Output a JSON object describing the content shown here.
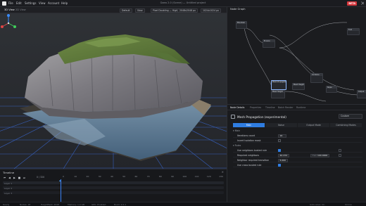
{
  "menubar": {
    "items": [
      "File",
      "Edit",
      "Settings",
      "View",
      "Account",
      "Help"
    ],
    "title": "Gaea 2.0 (Scene) — Untitled project",
    "beta": "BETA"
  },
  "viewport_toolbar": {
    "tabs": [
      "3D View",
      "2D View"
    ],
    "pills": [
      "Default",
      "View",
      "Pixel Doubling — High",
      "2048x2048 px",
      "1024x1024 px"
    ]
  },
  "node_graph": {
    "title": "Node Graph",
    "nodes": [
      "Mountain",
      "Erosion",
      "Mesh Propagation",
      "Fold",
      "Mask Height",
      "Combine",
      "Slope",
      "Mesh Height",
      "Output"
    ]
  },
  "details": {
    "panel_tabs": [
      "Node Details",
      "Properties",
      "Timeline",
      "Batch Render",
      "Runtime"
    ],
    "node_name": "Mesh Propagation (experimental)",
    "preset": "Custom",
    "mode_tabs": [
      "Main",
      "Noise",
      "Output Mode",
      "Combining Modes"
    ],
    "sections": {
      "main": "Main",
      "rules": "Rules"
    },
    "rows": [
      {
        "label": "Iterations count",
        "value": "16",
        "type": "value"
      },
      {
        "label": "Invert Isolation mask",
        "type": "check",
        "checked": false
      },
      {
        "label": "Use neighbors busted rule",
        "type": "check",
        "checked": true
      },
      {
        "label": "Required neighbors",
        "value": "40.234",
        "max_label": "max",
        "max_value": "100.0000",
        "type": "range"
      },
      {
        "label": "Neighbor required transition",
        "value": "5.000",
        "type": "value"
      },
      {
        "label": "Use cross busted rule",
        "type": "check",
        "checked": true
      }
    ]
  },
  "timeline": {
    "title": "Timeline",
    "frame": "0 / 320",
    "ticks": [
      "0",
      "10",
      "20",
      "30",
      "40",
      "50",
      "60",
      "70",
      "80",
      "90",
      "100",
      "110",
      "120",
      "130"
    ],
    "tracks": [
      "Layer 1",
      "Layer 2",
      "Layer 3"
    ]
  },
  "statusbar": {
    "items": [
      "Ready",
      "Nodes: 18",
      "Heightfield: 2048",
      "Memory: 1.4 GB",
      "GPU: Enabled",
      "Build: 2.0.1",
      "Auto-save: On",
      "Online"
    ]
  },
  "colors": {
    "accent": "#2f7de1",
    "beta": "#d6363c",
    "grid": "#3a6ad8",
    "water": "#5f7f9c",
    "grass": "#5f7a3a",
    "rock": "#8b8c92"
  }
}
